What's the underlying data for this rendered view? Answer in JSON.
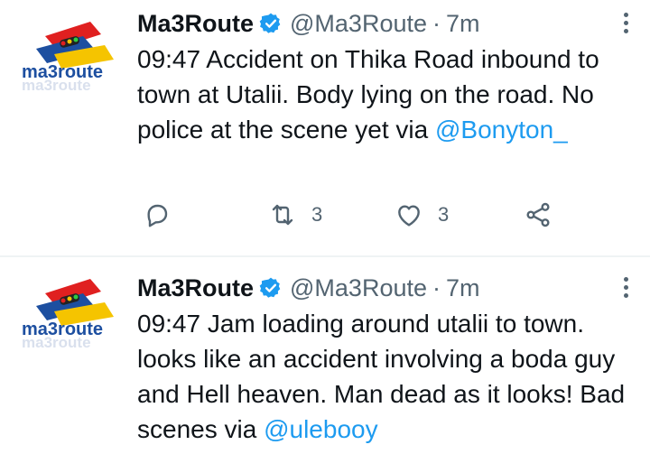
{
  "tweets": [
    {
      "name": "Ma3Route",
      "handle": "@Ma3Route",
      "separator": "·",
      "time": "7m",
      "text": "09:47 Accident on Thika Road inbound to town at Utalii. Body lying on the road. No police at the scene yet via ",
      "mention": "@Bonyton_",
      "retweets": "3",
      "likes": "3",
      "avatar_text": "ma3route",
      "avatar_reflection": "ma3route"
    },
    {
      "name": "Ma3Route",
      "handle": "@Ma3Route",
      "separator": "·",
      "time": "7m",
      "text": "09:47 Jam loading around utalii to town. looks like an accident involving a boda guy and Hell heaven. Man dead as it looks! Bad scenes via ",
      "mention": "@ulebooy",
      "avatar_text": "ma3route",
      "avatar_reflection": "ma3route"
    }
  ],
  "colors": {
    "text": "#0f1419",
    "secondary": "#536471",
    "link": "#1d9bf0",
    "verified": "#1d9bf0",
    "divider": "#eff3f4",
    "logo_red": "#e02020",
    "logo_blue": "#1d4fa0",
    "logo_yellow": "#f5c400"
  },
  "icons": [
    "verified-badge-icon",
    "more-options-icon",
    "reply-icon",
    "retweet-icon",
    "like-icon",
    "share-icon"
  ]
}
